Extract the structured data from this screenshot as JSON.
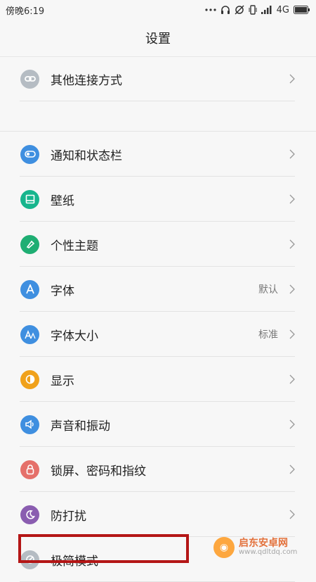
{
  "status": {
    "time": "傍晚6:19",
    "network": "4G"
  },
  "header": {
    "title": "设置"
  },
  "groups": [
    {
      "items": [
        {
          "label": "其他连接方式",
          "icon": "link-icon",
          "color": "#b5bcc3"
        }
      ]
    },
    {
      "items": [
        {
          "label": "通知和状态栏",
          "icon": "toggle-icon",
          "color": "#3f8fe0"
        },
        {
          "label": "壁纸",
          "icon": "wallpaper-icon",
          "color": "#17b58d"
        },
        {
          "label": "个性主题",
          "icon": "brush-icon",
          "color": "#1fae73"
        },
        {
          "label": "字体",
          "value": "默认",
          "icon": "font-a-icon",
          "color": "#3f8fe0"
        },
        {
          "label": "字体大小",
          "value": "标准",
          "icon": "font-size-icon",
          "color": "#3f8fe0"
        },
        {
          "label": "显示",
          "icon": "display-icon",
          "color": "#f0a11b"
        },
        {
          "label": "声音和振动",
          "icon": "speaker-icon",
          "color": "#3f8fe0"
        },
        {
          "label": "锁屏、密码和指纹",
          "icon": "lock-icon",
          "color": "#e5706a"
        },
        {
          "label": "防打扰",
          "icon": "moon-icon",
          "color": "#8a5db0"
        },
        {
          "label": "极简模式",
          "icon": "simple-mode-icon",
          "color": "#b5bcc3"
        }
      ]
    }
  ],
  "watermark": {
    "title": "启东安卓网",
    "url": "www.qdltdq.com"
  }
}
